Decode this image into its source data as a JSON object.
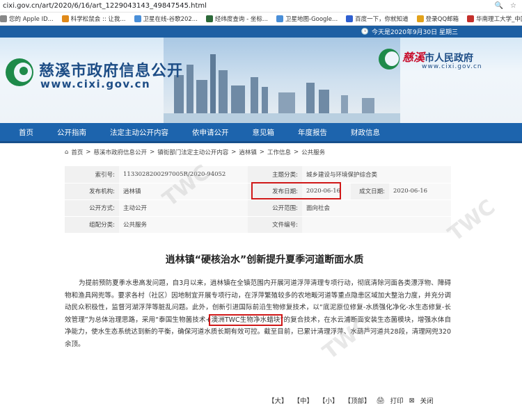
{
  "browser": {
    "url": "cixi.gov.cn/art/2020/6/16/art_1229043143_49847545.html"
  },
  "bookmarks": [
    {
      "label": "您的 Apple ID...",
      "color": "#888"
    },
    {
      "label": "科学松鼠会 :: 让我...",
      "color": "#e08a1a"
    },
    {
      "label": "卫星在线-谷歌202...",
      "color": "#4a8fd8"
    },
    {
      "label": "经纬度查询 - 坐标...",
      "color": "#2d6a3a"
    },
    {
      "label": "卫星地图-Google...",
      "color": "#4a8fd8"
    },
    {
      "label": "百度一下，你就知道",
      "color": "#2f5fd0"
    },
    {
      "label": "登录QQ邮箱",
      "color": "#e2a21a"
    },
    {
      "label": "华南理工大学_中国...",
      "color": "#c4302b"
    }
  ],
  "topbar": {
    "date": "今天是2020年9月30日 星期三"
  },
  "banner": {
    "title": "慈溪市政府信息公开",
    "url": "www.cixi.gov.cn",
    "gov_name_red": "慈溪",
    "gov_name_blue": "市人民政府",
    "gov_url": "www.cixi.gov.cn"
  },
  "nav": [
    "首页",
    "公开指南",
    "法定主动公开内容",
    "依申请公开",
    "意见箱",
    "年度报告",
    "财政信息"
  ],
  "breadcrumb": [
    "首页",
    "慈溪市政府信息公开",
    "镇街部门法定主动公开内容",
    "逍林镇",
    "工作信息",
    "公共服务"
  ],
  "meta": {
    "rows": [
      [
        {
          "label": "索引号:",
          "value": "11330282002970​05R/2020-94052"
        },
        {
          "label": "主题分类:",
          "value": "城乡建设与环境保护综合类"
        }
      ],
      [
        {
          "label": "发布机构:",
          "value": "逍林镇"
        },
        {
          "label": "发布日期:",
          "value": "2020-06-16"
        },
        {
          "label": "成文日期:",
          "value": "2020-06-16"
        }
      ],
      [
        {
          "label": "公开方式:",
          "value": "主动公开"
        },
        {
          "label": "公开范围:",
          "value": "面向社会"
        }
      ],
      [
        {
          "label": "组配分类:",
          "value": "公共服务"
        },
        {
          "label": "文件编号:",
          "value": ""
        }
      ]
    ]
  },
  "article": {
    "title": "逍林镇“硬核治水”创新提升夏季河道断面水质",
    "p_before": "为提前预防夏季水患高发问题，自3月以来，逍林镇在全镇范围内开展河道浮萍清理专项行动，彻底清除河面各类漂浮物、障碍物和渔具网兜等。要求各村（社区）因地制宜开展专项行动，在浮萍繁殖较多的农地畈河道等重点隐患区域加大整治力度，并充分调动民众积极性，监督河湖浮萍等脏乱问题。此外，创新引进国际前沿生物修复技术，以“底泥原位修复-水质强化净化-水生态修复-长效管理”为总体治理思路，采用“泰国生物菌技术+",
    "p_highlight": "澳洲TWC生物净水蜡块",
    "p_after": "”的复合技术，在水云浦断面安装生态菌模块，增强水体自净能力，使水生态系统达到新的平衡，确保河道水质长期有效可控。截至目前，已累计清理浮萍、水葫芦河道共28段，清理网兜320余顶。"
  },
  "footer": {
    "large": "【大】",
    "medium": "【中】",
    "small": "【小】",
    "top": "【顶部】",
    "print": "打印",
    "close": "关闭"
  },
  "watermark": "TWC"
}
